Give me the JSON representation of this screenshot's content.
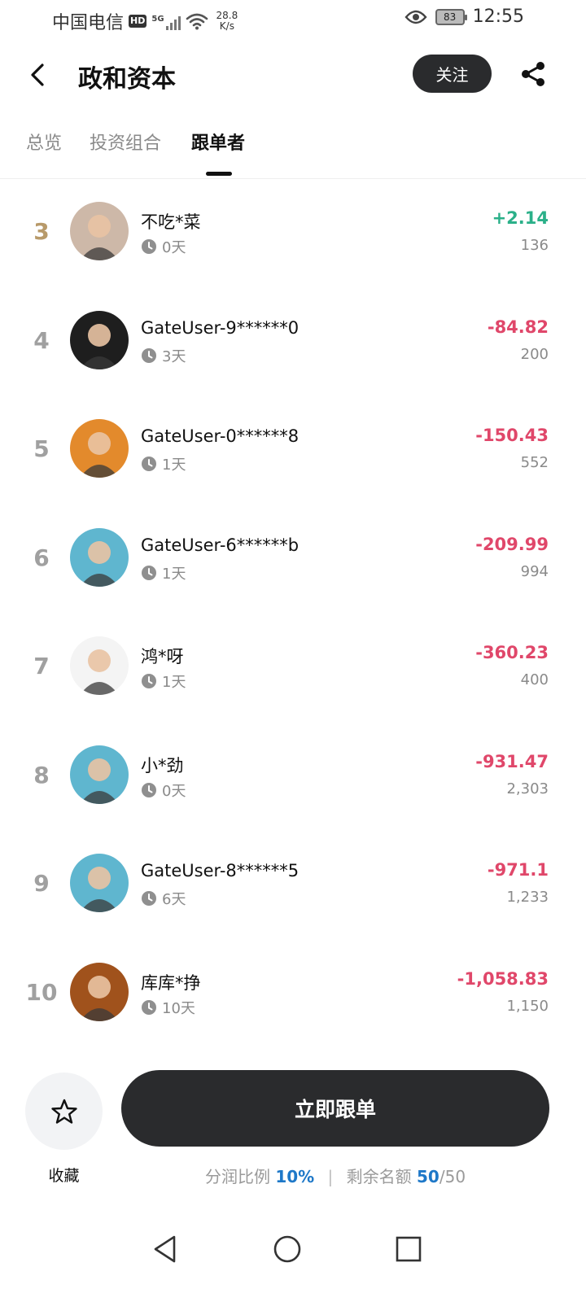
{
  "status_bar": {
    "carrier": "中国电信",
    "hd": "HD",
    "network": "5G",
    "speed_value": "28.8",
    "speed_unit": "K/s",
    "battery": "83",
    "time": "12:55"
  },
  "header": {
    "title": "政和资本",
    "follow_label": "关注"
  },
  "tabs": [
    {
      "label": "总览",
      "active": false
    },
    {
      "label": "投资组合",
      "active": false
    },
    {
      "label": "跟单者",
      "active": true
    }
  ],
  "followers": [
    {
      "rank": "3",
      "name": "不吃*菜",
      "days": "0天",
      "pnl": "+2.14",
      "amount": "136",
      "pnl_color": "#2bb089",
      "avatar_bg": "#cdb8a8"
    },
    {
      "rank": "4",
      "name": "GateUser-9******0",
      "days": "3天",
      "pnl": "-84.82",
      "amount": "200",
      "pnl_color": "#e0476a",
      "avatar_bg": "#1e1e1e"
    },
    {
      "rank": "5",
      "name": "GateUser-0******8",
      "days": "1天",
      "pnl": "-150.43",
      "amount": "552",
      "pnl_color": "#e0476a",
      "avatar_bg": "#e38a2c"
    },
    {
      "rank": "6",
      "name": "GateUser-6******b",
      "days": "1天",
      "pnl": "-209.99",
      "amount": "994",
      "pnl_color": "#e0476a",
      "avatar_bg": "#5fb6cf"
    },
    {
      "rank": "7",
      "name": "鸿*呀",
      "days": "1天",
      "pnl": "-360.23",
      "amount": "400",
      "pnl_color": "#e0476a",
      "avatar_bg": "#f4f4f4"
    },
    {
      "rank": "8",
      "name": "小*劲",
      "days": "0天",
      "pnl": "-931.47",
      "amount": "2,303",
      "pnl_color": "#e0476a",
      "avatar_bg": "#5fb6cf"
    },
    {
      "rank": "9",
      "name": "GateUser-8******5",
      "days": "6天",
      "pnl": "-971.1",
      "amount": "1,233",
      "pnl_color": "#e0476a",
      "avatar_bg": "#5fb6cf"
    },
    {
      "rank": "10",
      "name": "库库*挣",
      "days": "10天",
      "pnl": "-1,058.83",
      "amount": "1,150",
      "pnl_color": "#e0476a",
      "avatar_bg": "#a0521c"
    }
  ],
  "bottom": {
    "favorite_label": "收藏",
    "follow_now_label": "立即跟单",
    "profit_share_label": "分润比例",
    "profit_share_value": "10%",
    "separator": "|",
    "remaining_label": "剩余名额",
    "remaining_current": "50",
    "remaining_total": "/50"
  },
  "icons": {
    "back": "back-arrow-icon",
    "share": "share-icon",
    "clock": "clock-icon",
    "star": "star-icon",
    "nav_back": "nav-back-icon",
    "nav_home": "nav-home-icon",
    "nav_recent": "nav-recent-icon"
  }
}
